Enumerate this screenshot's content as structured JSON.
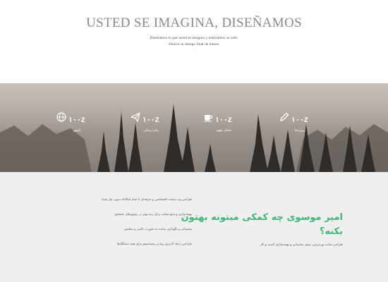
{
  "hero": {
    "title": "USTED SE IMAGINA, DISEÑAMOS",
    "subtitle_line1": "Diseñamos lo que usted se imagina y realizamos su web.",
    "subtitle_line2": "Ahorre su tiempo final de meses."
  },
  "stats": [
    {
      "icon": "pencil-icon",
      "value": "۱۰۰Z",
      "label": "پروژه‌ها"
    },
    {
      "icon": "coffee-cup-icon",
      "value": "۱۰۰Z",
      "label": "فنجان قهوه"
    },
    {
      "icon": "paper-plane-icon",
      "value": "۱۰۰Z",
      "label": "پیام ارسالی"
    },
    {
      "icon": "globe-icon",
      "value": "۱۰۰Z",
      "label": "کشور"
    }
  ],
  "section": {
    "heading": "امیر موسوی چه کمکی میتونه بهتون بکنه؟",
    "description": "طراحی سایت وردپرس، سئو، پشتیبانی و بهینه‌سازی کسب و کار",
    "features": [
      "طراحی وب سایت اختصاصی و حرفه‌ای با تمام امکانات مورد نیاز شما",
      "بهینه‌سازی و سئو سایت برای رتبه بهتر در موتورهای جستجو",
      "پشتیبانی و نگهداری سایت به صورت دائمی و مطمئن",
      "طراحی رابط کاربری زیبا و ریسپانسیو برای همه دستگاه‌ها"
    ]
  },
  "colors": {
    "accent": "#3cb878",
    "banner": "#8f8882"
  }
}
